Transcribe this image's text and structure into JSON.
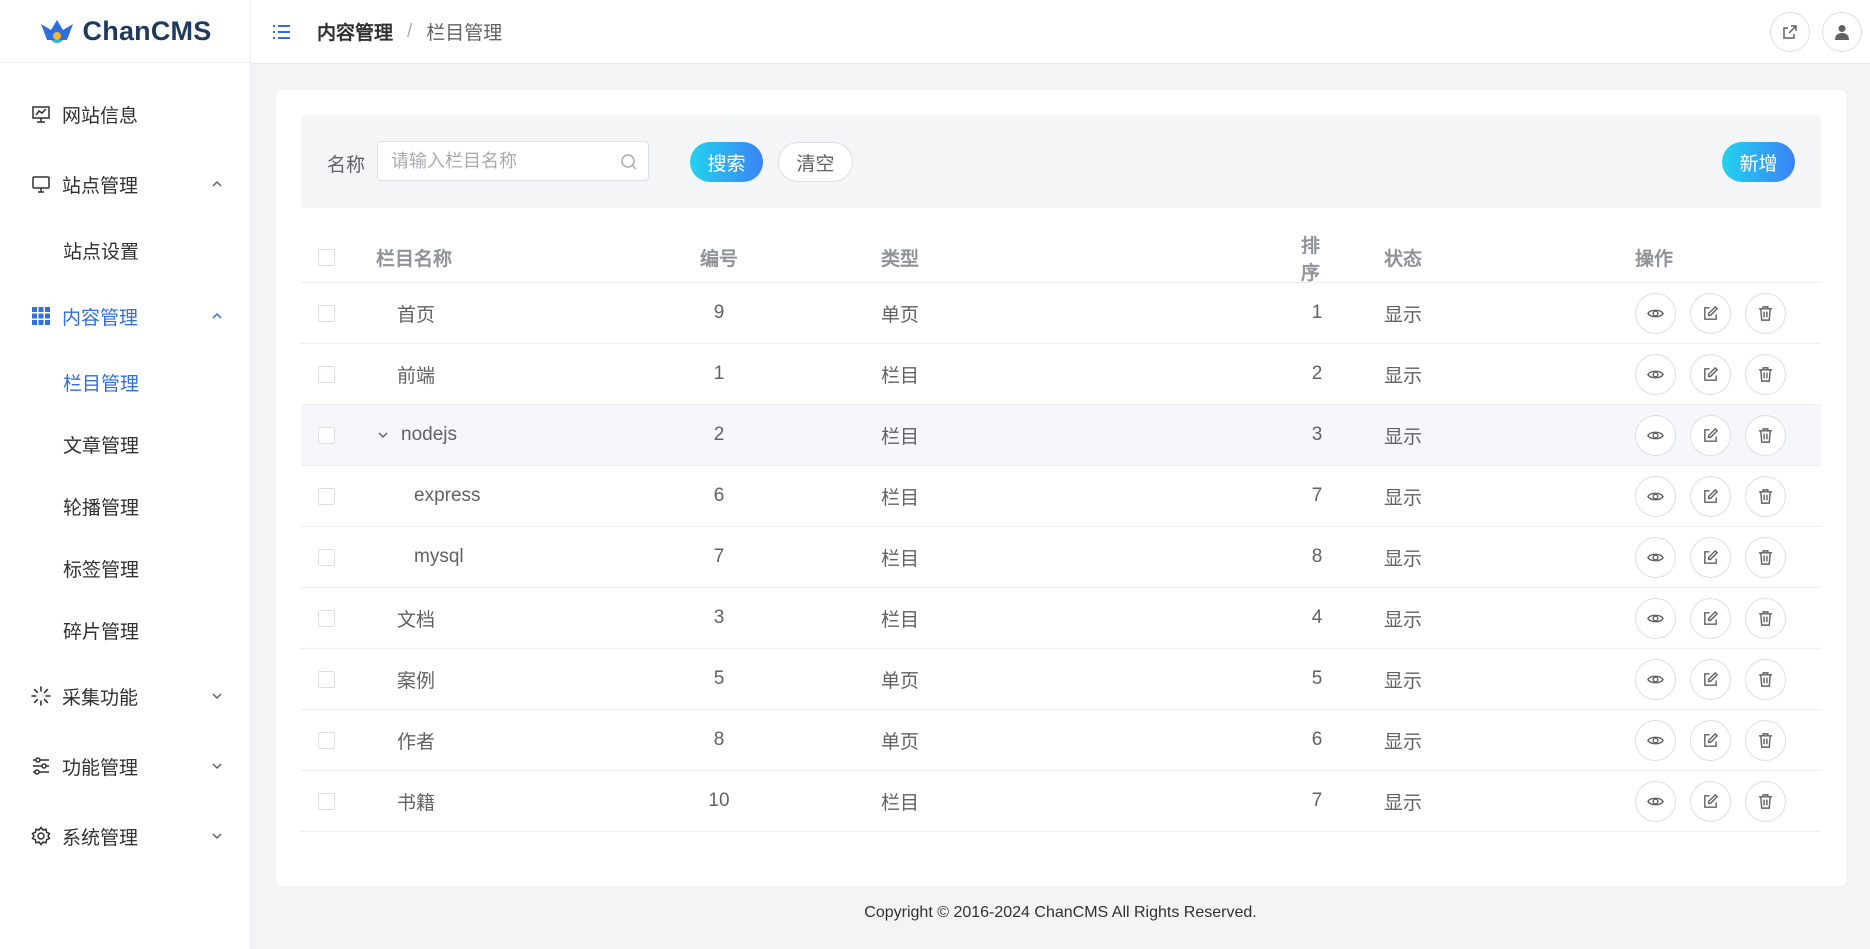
{
  "app": {
    "logo_text": "ChanCMS"
  },
  "sidebar": {
    "items": [
      {
        "label": "网站信息",
        "icon": "presentation-icon"
      },
      {
        "label": "站点管理",
        "icon": "monitor-icon",
        "expanded": true,
        "children": [
          "站点设置"
        ]
      },
      {
        "label": "内容管理",
        "icon": "grid-icon",
        "expanded": true,
        "active": true,
        "children": [
          "栏目管理",
          "文章管理",
          "轮播管理",
          "标签管理",
          "碎片管理"
        ],
        "active_child": "栏目管理"
      },
      {
        "label": "采集功能",
        "icon": "loading-icon",
        "expanded": false
      },
      {
        "label": "功能管理",
        "icon": "sliders-icon",
        "expanded": false
      },
      {
        "label": "系统管理",
        "icon": "gear-icon",
        "expanded": false
      }
    ]
  },
  "header": {
    "breadcrumb": [
      "内容管理",
      "栏目管理"
    ],
    "separator": "/"
  },
  "search": {
    "label": "名称",
    "placeholder": "请输入栏目名称",
    "search_button": "搜索",
    "clear_button": "清空",
    "add_button": "新增"
  },
  "table": {
    "columns": [
      "栏目名称",
      "编号",
      "类型",
      "排序",
      "状态",
      "操作"
    ],
    "rows": [
      {
        "name": "首页",
        "id": "9",
        "type": "单页",
        "sort": "1",
        "status": "显示",
        "level": 0
      },
      {
        "name": "前端",
        "id": "1",
        "type": "栏目",
        "sort": "2",
        "status": "显示",
        "level": 0
      },
      {
        "name": "nodejs",
        "id": "2",
        "type": "栏目",
        "sort": "3",
        "status": "显示",
        "level": 0,
        "expanded": true
      },
      {
        "name": "express",
        "id": "6",
        "type": "栏目",
        "sort": "7",
        "status": "显示",
        "level": 1
      },
      {
        "name": "mysql",
        "id": "7",
        "type": "栏目",
        "sort": "8",
        "status": "显示",
        "level": 1
      },
      {
        "name": "文档",
        "id": "3",
        "type": "栏目",
        "sort": "4",
        "status": "显示",
        "level": 0
      },
      {
        "name": "案例",
        "id": "5",
        "type": "单页",
        "sort": "5",
        "status": "显示",
        "level": 0
      },
      {
        "name": "作者",
        "id": "8",
        "type": "单页",
        "sort": "6",
        "status": "显示",
        "level": 0
      },
      {
        "name": "书籍",
        "id": "10",
        "type": "栏目",
        "sort": "7",
        "status": "显示",
        "level": 0
      }
    ]
  },
  "footer": {
    "copyright": "Copyright © 2016-2024 ChanCMS All Rights Reserved."
  },
  "colors": {
    "accent": "#2f6fe0",
    "gradient_start": "#22d3ee",
    "gradient_end": "#3b82f6"
  }
}
